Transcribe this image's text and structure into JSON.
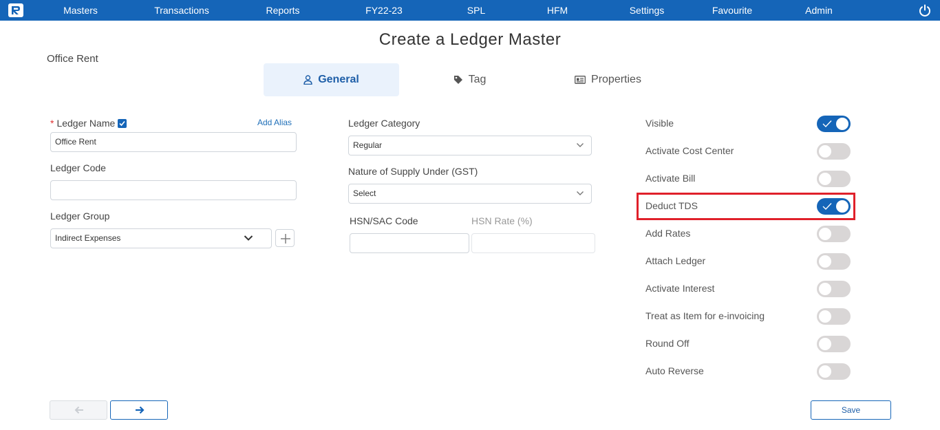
{
  "nav": {
    "logo_icon": "app-logo-icon",
    "items": [
      "Masters",
      "Transactions",
      "Reports",
      "FY22-23",
      "SPL",
      "HFM",
      "Settings",
      "Favourite",
      "Admin"
    ],
    "power_icon": "power-icon"
  },
  "page": {
    "title": "Create a Ledger Master",
    "subtitle": "Office Rent"
  },
  "tabs": [
    {
      "label": "General",
      "icon": "user-icon",
      "active": true
    },
    {
      "label": "Tag",
      "icon": "tag-icon",
      "active": false
    },
    {
      "label": "Properties",
      "icon": "id-card-icon",
      "active": false
    }
  ],
  "form": {
    "ledger_name_label": "Ledger Name",
    "required_mark": "*",
    "add_alias": "Add Alias",
    "ledger_name_value": "Office Rent",
    "ledger_code_label": "Ledger Code",
    "ledger_code_value": "",
    "ledger_group_label": "Ledger Group",
    "ledger_group_value": "Indirect Expenses",
    "ledger_category_label": "Ledger Category",
    "ledger_category_value": "Regular",
    "nature_supply_label": "Nature of Supply Under (GST)",
    "nature_supply_value": "Select",
    "hsn_code_label": "HSN/SAC Code",
    "hsn_code_value": "",
    "hsn_rate_label": "HSN Rate (%)",
    "hsn_rate_value": ""
  },
  "toggles": [
    {
      "label": "Visible",
      "on": true
    },
    {
      "label": "Activate Cost Center",
      "on": false
    },
    {
      "label": "Activate Bill",
      "on": false
    },
    {
      "label": "Deduct TDS",
      "on": true
    },
    {
      "label": "Add Rates",
      "on": false
    },
    {
      "label": "Attach Ledger",
      "on": false
    },
    {
      "label": "Activate Interest",
      "on": false
    },
    {
      "label": "Treat as Item for e-invoicing",
      "on": false
    },
    {
      "label": "Round Off",
      "on": false
    },
    {
      "label": "Auto Reverse",
      "on": false
    }
  ],
  "footer": {
    "save_label": "Save",
    "prev_icon": "arrow-left-icon",
    "next_icon": "arrow-right-icon"
  },
  "colors": {
    "brand": "#1565b8",
    "highlight": "#e0202a",
    "toggle_off": "#d9d6d6"
  }
}
